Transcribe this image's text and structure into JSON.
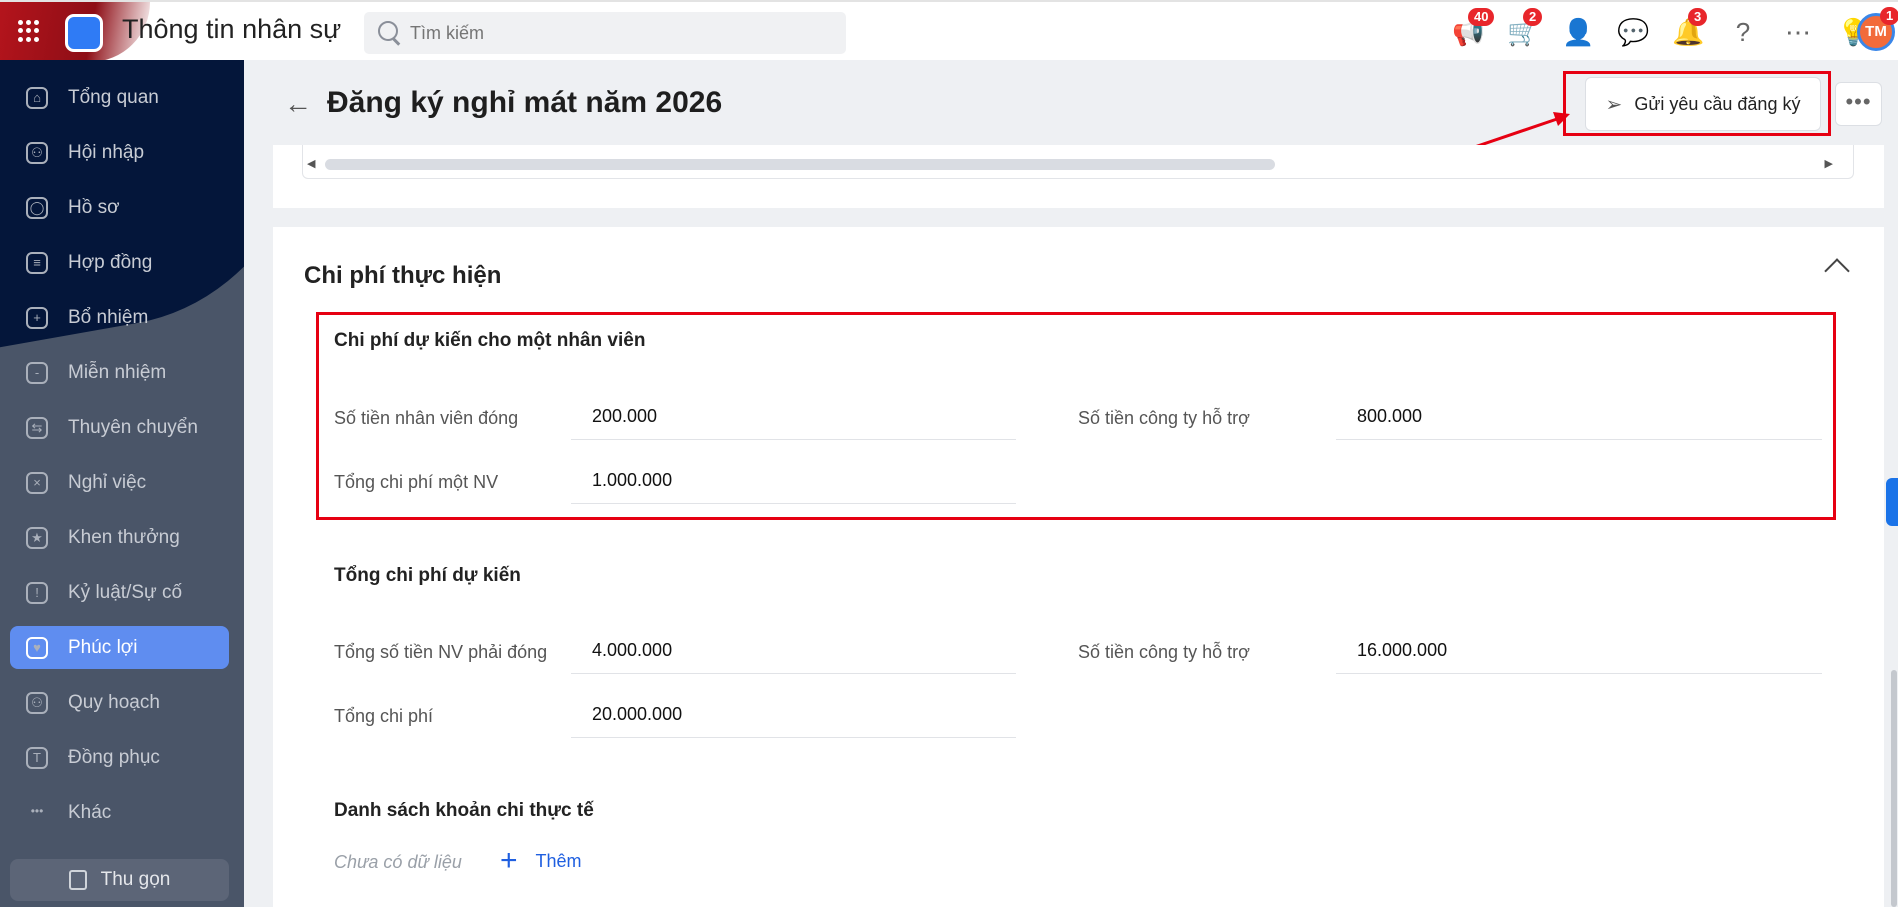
{
  "header": {
    "app_title": "Thông tin nhân sự",
    "search_placeholder": "Tìm kiếm",
    "icons": [
      {
        "name": "megaphone-icon",
        "glyph": "📢",
        "badge": "40"
      },
      {
        "name": "cart-icon",
        "glyph": "🛒",
        "badge": "2"
      },
      {
        "name": "add-user-icon",
        "glyph": "👤",
        "badge": null
      },
      {
        "name": "chat-icon",
        "glyph": "💬",
        "badge": null
      },
      {
        "name": "bell-icon",
        "glyph": "🔔",
        "badge": "3"
      },
      {
        "name": "help-icon",
        "glyph": "?",
        "badge": null
      },
      {
        "name": "more-circle-icon",
        "glyph": "⋯",
        "badge": null
      },
      {
        "name": "idea-icon",
        "glyph": "💡",
        "badge": null
      }
    ],
    "avatar": {
      "initials": "TM",
      "badge": "1",
      "color": "#f26b3a"
    }
  },
  "sidebar": {
    "items": [
      {
        "label": "Tổng quan",
        "icon": "⌂"
      },
      {
        "label": "Hội nhập",
        "icon": "⚇"
      },
      {
        "label": "Hồ sơ",
        "icon": "◯"
      },
      {
        "label": "Hợp đồng",
        "icon": "≡"
      },
      {
        "label": "Bổ nhiệm",
        "icon": "+"
      },
      {
        "label": "Miễn nhiệm",
        "icon": "-"
      },
      {
        "label": "Thuyên chuyển",
        "icon": "⇆"
      },
      {
        "label": "Nghỉ việc",
        "icon": "×"
      },
      {
        "label": "Khen thưởng",
        "icon": "★"
      },
      {
        "label": "Kỷ luật/Sự cố",
        "icon": "!"
      },
      {
        "label": "Phúc lợi",
        "icon": "♥",
        "active": true
      },
      {
        "label": "Quy hoạch",
        "icon": "⚇"
      },
      {
        "label": "Đồng phục",
        "icon": "T"
      },
      {
        "label": "Khác",
        "icon": "•••"
      }
    ],
    "collapse_label": "Thu gọn"
  },
  "page": {
    "title": "Đăng ký nghỉ mát năm 2026",
    "send_button": "Gửi yêu cầu đăng ký",
    "more_button": "•••"
  },
  "section": {
    "title": "Chi phí thực hiện",
    "per_employee": {
      "title": "Chi phí dự kiến cho một nhân viên",
      "fields": [
        {
          "label": "Số tiền nhân viên đóng",
          "value": "200.000"
        },
        {
          "label": "Số tiền công ty hỗ trợ",
          "value": "800.000"
        },
        {
          "label": "Tổng chi phí một NV",
          "value": "1.000.000"
        }
      ]
    },
    "total": {
      "title": "Tổng chi phí dự kiến",
      "fields": [
        {
          "label": "Tổng số tiền NV phải đóng",
          "value": "4.000.000"
        },
        {
          "label": "Số tiền công ty hỗ trợ",
          "value": "16.000.000"
        },
        {
          "label": "Tổng chi phí",
          "value": "20.000.000"
        }
      ]
    },
    "actual": {
      "title": "Danh sách khoản chi thực tế",
      "empty": "Chưa có dữ liệu",
      "add_label": "Thêm"
    }
  },
  "colors": {
    "highlight": "#e60012",
    "accent": "#5f8df0",
    "link": "#1f5fe0"
  }
}
